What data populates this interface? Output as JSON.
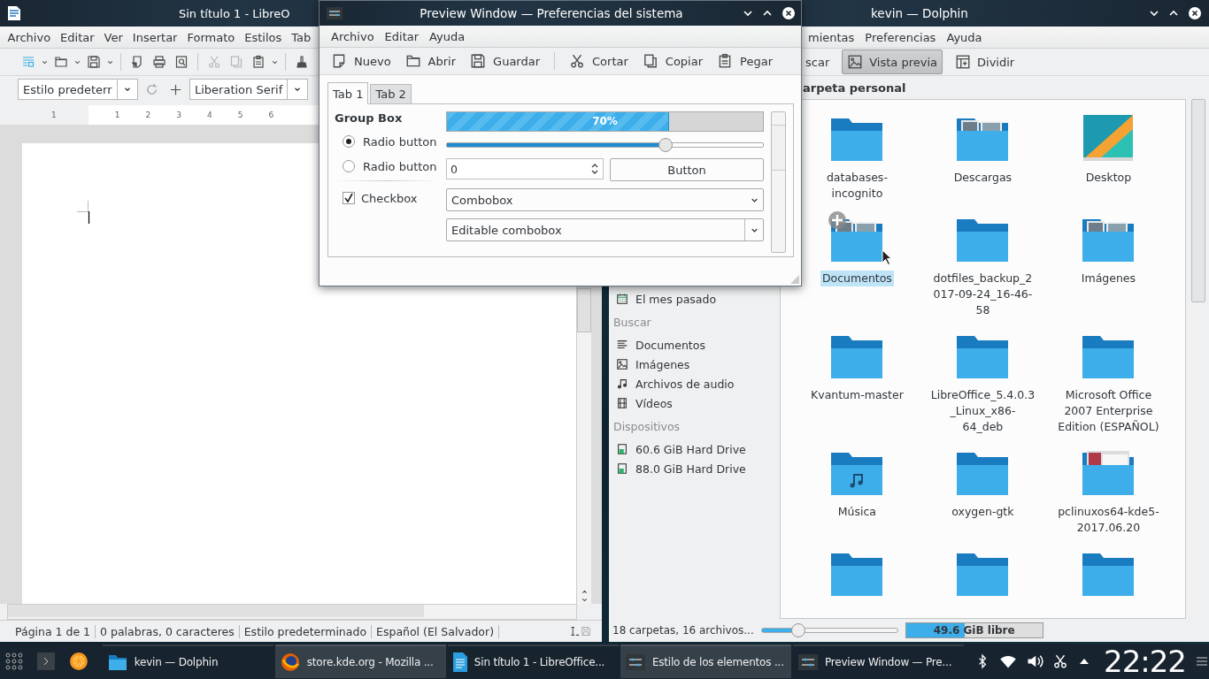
{
  "writer": {
    "title": "Sin título 1 - LibreO",
    "menu": [
      "Archivo",
      "Editar",
      "Ver",
      "Insertar",
      "Formato",
      "Estilos",
      "Tab"
    ],
    "paragraph_style": "Estilo predeterr",
    "font_name": "Liberation Serif",
    "ruler": [
      "1",
      "1",
      "2",
      "3",
      "4",
      "5",
      "6"
    ],
    "status": [
      "Página 1 de 1",
      "0 palabras, 0 caracteres",
      "Estilo predeterminado",
      "Español (El Salvador)"
    ]
  },
  "dolphin": {
    "title": "kevin — Dolphin",
    "menu": [
      "mientas",
      "Preferencias",
      "Ayuda"
    ],
    "toolbar": [
      {
        "label": "scar",
        "kind": "plain",
        "selected": false
      },
      {
        "label": "Vista previa",
        "kind": "preview",
        "selected": true
      },
      {
        "label": "Dividir",
        "kind": "split",
        "selected": false
      }
    ],
    "location": "arpeta personal",
    "places": [
      {
        "kind": "calendar",
        "label": "El mes pasado"
      },
      {
        "kind": "header",
        "label": "Buscar"
      },
      {
        "kind": "documents",
        "label": "Documentos"
      },
      {
        "kind": "images",
        "label": "Imágenes"
      },
      {
        "kind": "audio",
        "label": "Archivos de audio"
      },
      {
        "kind": "videos",
        "label": "Vídeos"
      },
      {
        "kind": "header",
        "label": "Dispositivos"
      },
      {
        "kind": "drive",
        "label": "60.6 GiB Hard Drive"
      },
      {
        "kind": "drive",
        "label": "88.0 GiB Hard Drive"
      }
    ],
    "files": [
      {
        "name": "databases-incognito",
        "kind": "folder",
        "selected": false
      },
      {
        "name": "Descargas",
        "kind": "photos-folder",
        "selected": false
      },
      {
        "name": "Desktop",
        "kind": "desktop",
        "selected": false
      },
      {
        "name": "Documentos",
        "kind": "photos-folder",
        "selected": true
      },
      {
        "name": "dotfiles_backup_2017-09-24_16-46-58",
        "kind": "folder",
        "selected": false
      },
      {
        "name": "Imágenes",
        "kind": "photos-folder",
        "selected": false
      },
      {
        "name": "Kvantum-master",
        "kind": "folder",
        "selected": false
      },
      {
        "name": "LibreOffice_5.4.0.3_Linux_x86-64_deb",
        "kind": "folder",
        "selected": false
      },
      {
        "name": "Microsoft Office 2007 Enterprise Edition (ESPAÑOL)",
        "kind": "folder",
        "selected": false
      },
      {
        "name": "Música",
        "kind": "music-folder",
        "selected": false
      },
      {
        "name": "oxygen-gtk",
        "kind": "folder",
        "selected": false
      },
      {
        "name": "pclinuxos64-kde5-2017.06.20",
        "kind": "screenshot-folder",
        "selected": false
      },
      {
        "kind": "folder",
        "selected": false
      },
      {
        "kind": "folder",
        "selected": false
      },
      {
        "kind": "folder",
        "selected": false
      }
    ],
    "status": "18 carpetas, 16 archivos...",
    "zoom": {
      "level": 0.27
    },
    "free_space": {
      "label": "49.6 GiB libre",
      "level": 0.43
    }
  },
  "preview": {
    "title": "Preview Window — Preferencias del sistema",
    "menu": [
      "Archivo",
      "Editar",
      "Ayuda"
    ],
    "toolbar": [
      {
        "label": "Nuevo",
        "kind": "new"
      },
      {
        "label": "Abrir",
        "kind": "open"
      },
      {
        "label": "Guardar",
        "kind": "save"
      },
      {
        "label": "Cortar",
        "kind": "cut"
      },
      {
        "label": "Copiar",
        "kind": "copy"
      },
      {
        "label": "Pegar",
        "kind": "paste"
      }
    ],
    "tabs": [
      {
        "label": "Tab 1",
        "selected": true
      },
      {
        "label": "Tab 2",
        "selected": false
      }
    ],
    "group_box": {
      "title": "Group Box",
      "radios": [
        {
          "label": "Radio button",
          "selected": true
        },
        {
          "label": "Radio button",
          "selected": false
        }
      ],
      "checkbox": {
        "label": "Checkbox",
        "checked": true
      }
    },
    "progress": {
      "text": "70%",
      "level": 0.7
    },
    "slider": {
      "level": 0.69
    },
    "spinbox": {
      "value": "0"
    },
    "button": "Button",
    "combobox": "Combobox",
    "editable_combobox": {
      "value": "Editable combobox"
    }
  },
  "taskbar": {
    "tasks": [
      {
        "title": "kevin — Dolphin",
        "kind": "folder",
        "selected": false
      },
      {
        "title": "store.kde.org - Mozilla ...",
        "kind": "browser",
        "selected": true
      },
      {
        "title": "Sin título 1 - LibreOffice...",
        "kind": "document",
        "selected": false
      },
      {
        "title": "Estilo de los elementos ...",
        "kind": "settings",
        "selected": true
      },
      {
        "title": "Preview Window — Pre...",
        "kind": "settings",
        "selected": false
      }
    ],
    "clock": "22:22"
  }
}
